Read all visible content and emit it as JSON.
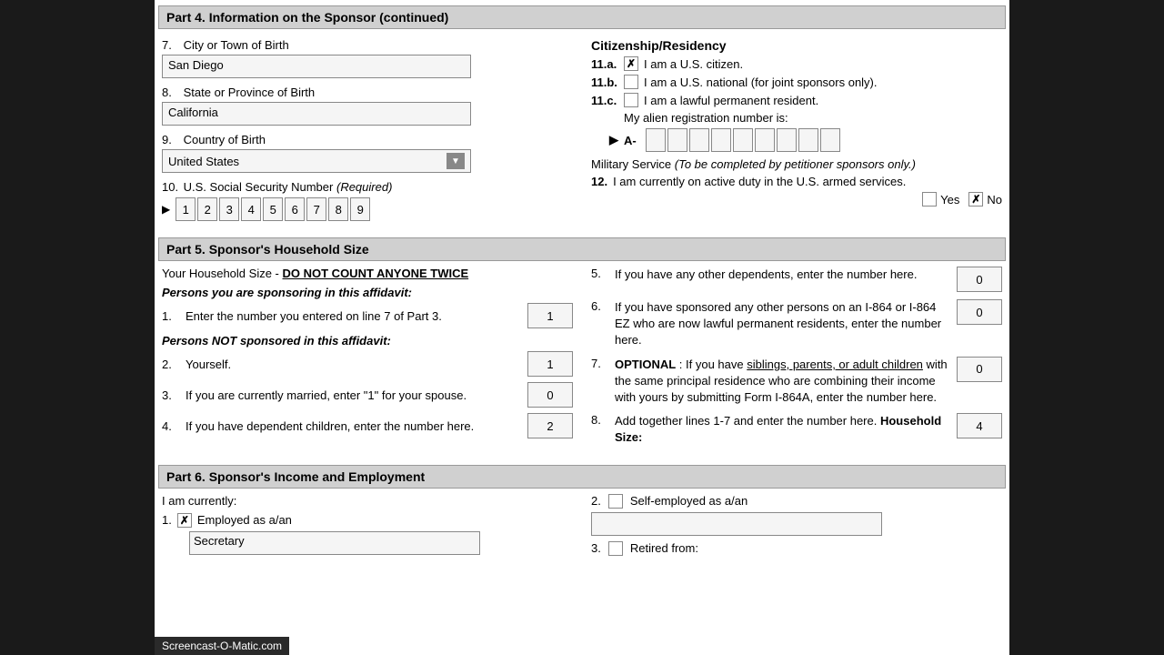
{
  "partHeader": {
    "title": "Part 4. Information on the Sponsor (continued)"
  },
  "leftFields": {
    "field7": {
      "number": "7.",
      "label": "City or Town of Birth",
      "value": "San Diego"
    },
    "field8": {
      "number": "8.",
      "label": "State or Province of Birth",
      "value": "California"
    },
    "field9": {
      "number": "9.",
      "label": "Country of Birth",
      "value": "United States"
    },
    "field10": {
      "number": "10.",
      "label": "U.S. Social Security Number",
      "labelSuffix": "(Required)",
      "ssn_boxes": [
        "1",
        "2",
        "3",
        "4",
        "5",
        "6",
        "7",
        "8",
        "9"
      ]
    }
  },
  "rightFields": {
    "citizenshipTitle": "Citizenship/Residency",
    "item11a": {
      "label": "11.a.",
      "text": "I am a U.S. citizen.",
      "checked": true
    },
    "item11b": {
      "label": "11.b.",
      "text": "I am a U.S. national (for joint sponsors only).",
      "checked": false
    },
    "item11c": {
      "label": "11.c.",
      "text": "I am a lawful permanent resident.",
      "checked": false
    },
    "alienLabel": "My alien registration number is:",
    "alienPrefix": "A-",
    "militaryTitle": "Military Service",
    "militaryTitleNote": "(To be completed by petitioner sponsors only.)",
    "item12": {
      "number": "12.",
      "text": "I am currently on active duty in the U.S. armed services.",
      "yesLabel": "Yes",
      "noLabel": "No",
      "yesChecked": false,
      "noChecked": true
    }
  },
  "part5": {
    "header": "Part 5. Sponsor's Household Size",
    "intro": "Your Household Size -",
    "noCount": "DO NOT COUNT ANYONE TWICE",
    "sponsoringLabel": "Persons you are sponsoring in this affidavit:",
    "notSponsoringLabel": "Persons NOT sponsored in this affidavit:",
    "leftItems": [
      {
        "number": "1.",
        "text": "Enter the number you entered on line 7 of Part 3.",
        "value": "1"
      },
      {
        "number": "2.",
        "text": "Yourself.",
        "value": "1"
      },
      {
        "number": "3.",
        "text": "If you are currently married, enter \"1\" for your spouse.",
        "value": "0"
      },
      {
        "number": "4.",
        "text": "If you have dependent children, enter the number here.",
        "value": "2"
      }
    ],
    "rightItems": [
      {
        "number": "5.",
        "text": "If you have any other dependents, enter the number here.",
        "value": "0"
      },
      {
        "number": "6.",
        "text": "If you have sponsored any other persons on an I-864 or I-864 EZ who are now lawful permanent residents, enter the number here.",
        "value": "0"
      },
      {
        "number": "7.",
        "optionalLabel": "OPTIONAL",
        "text": ": If you have",
        "underlineText": "siblings, parents, or adult children",
        "text2": " with the same principal residence who are combining their income with yours by submitting Form I-864A, enter the number here.",
        "value": "0"
      },
      {
        "number": "8.",
        "text": "Add together lines 1-7 and enter the number here. ",
        "boldText": "Household Size:",
        "value": "4"
      }
    ]
  },
  "part6": {
    "header": "Part 6. Sponsor's Income and Employment",
    "currentlyLabel": "I am currently:",
    "leftItems": [
      {
        "number": "1.",
        "checkChecked": true,
        "label": "Employed as a/an",
        "inputValue": "Secretary"
      }
    ],
    "rightItems": [
      {
        "number": "2.",
        "checkChecked": false,
        "label": "Self-employed as a/an",
        "inputValue": ""
      },
      {
        "number": "3.",
        "checkChecked": false,
        "label": "Retired from:",
        "inputValue": ""
      }
    ]
  },
  "watermark": "Screencast-O-Matic.com"
}
